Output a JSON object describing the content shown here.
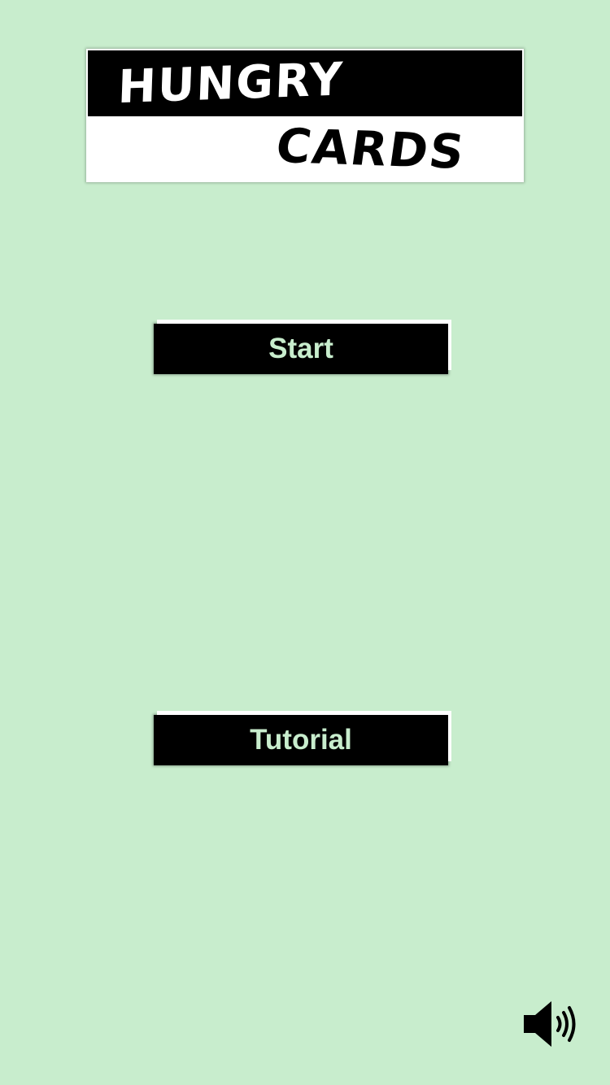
{
  "logo": {
    "line1": "HUNGRY",
    "line2": "CARDS"
  },
  "menu": {
    "start_label": "Start",
    "tutorial_label": "Tutorial"
  },
  "sound": {
    "icon": "speaker-volume-icon",
    "state": "on"
  },
  "colors": {
    "background": "#c8edcd",
    "button_fill": "#000000",
    "button_text": "#c8edcd",
    "logo_band": "#000000",
    "logo_paper": "#ffffff"
  }
}
